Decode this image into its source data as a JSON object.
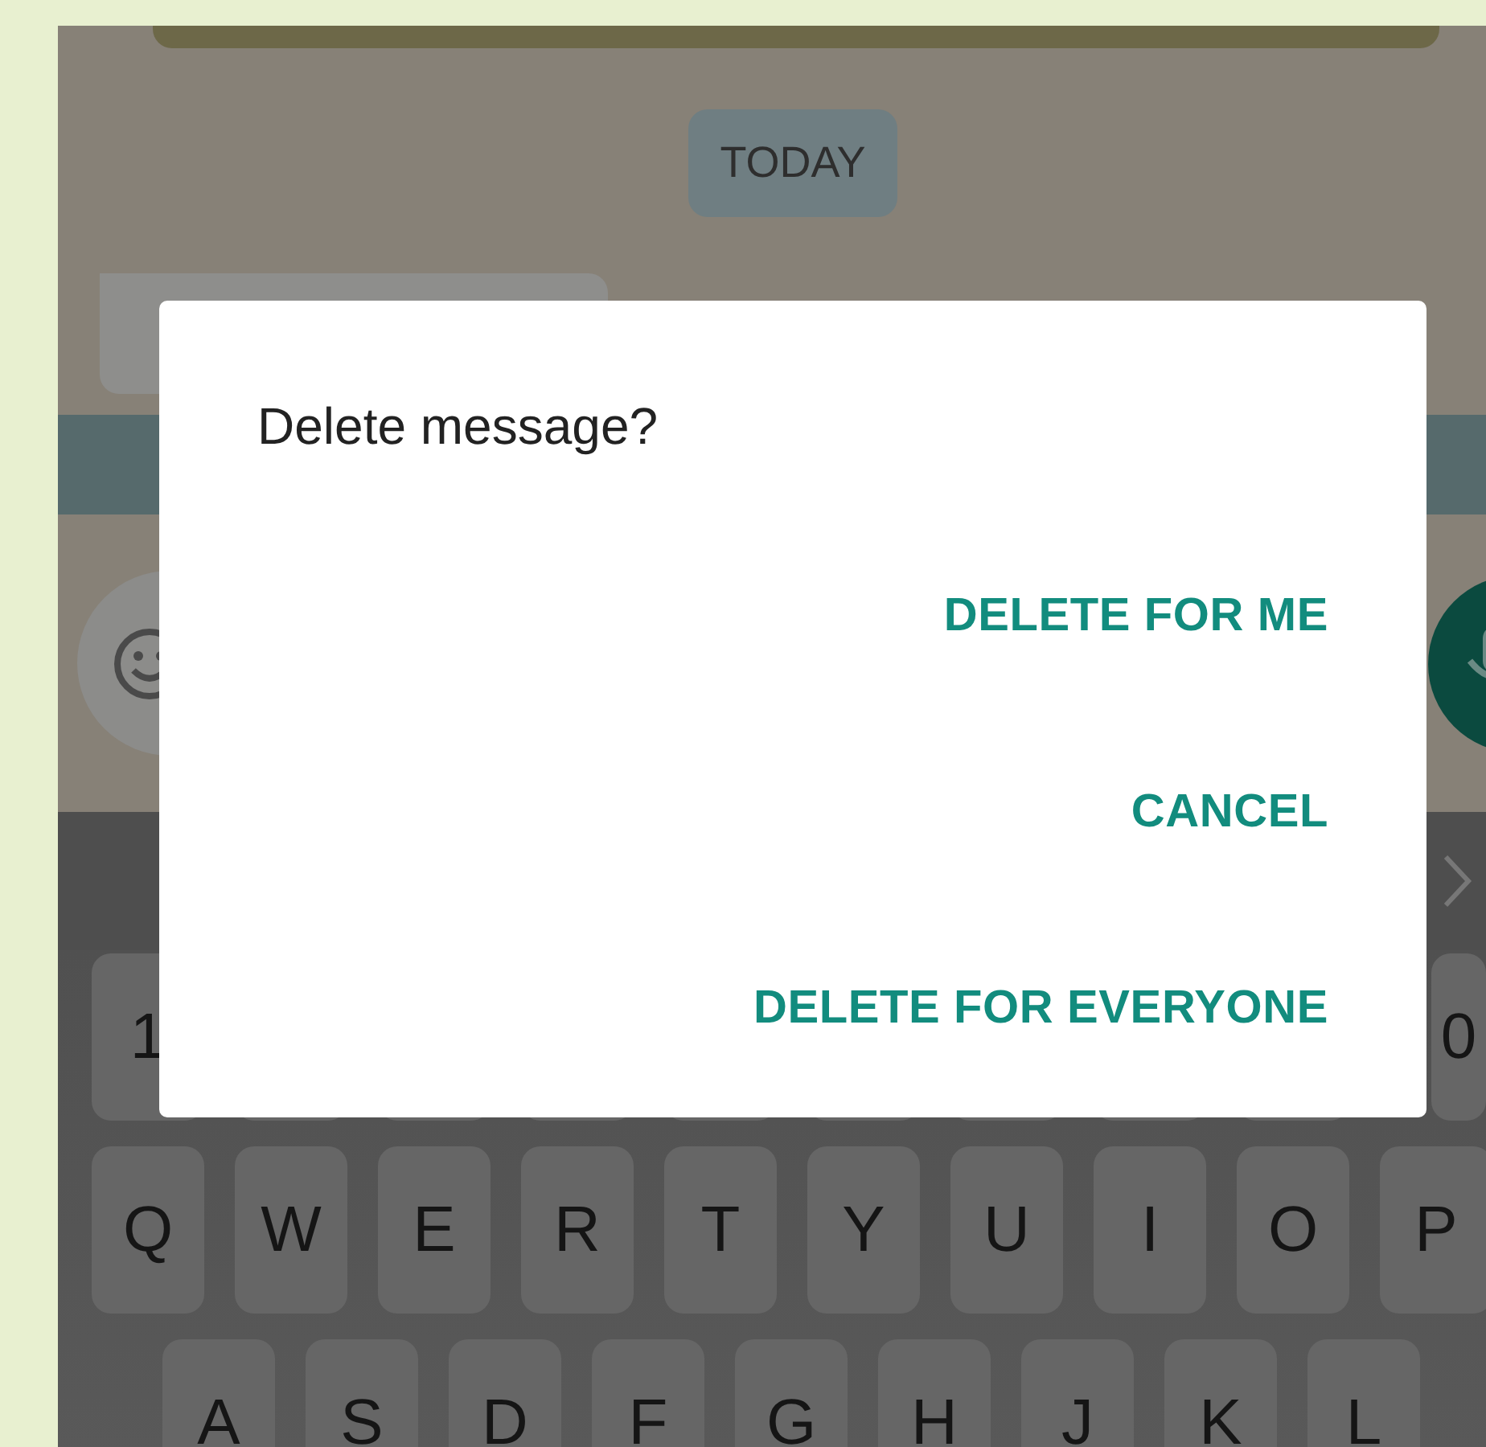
{
  "chat": {
    "date_chip": "TODAY"
  },
  "keyboard": {
    "number_row": [
      "1",
      "0"
    ],
    "rows": [
      [
        "Q",
        "W",
        "E",
        "R",
        "T",
        "Y",
        "U",
        "I",
        "O",
        "P"
      ],
      [
        "A",
        "S",
        "D",
        "F",
        "G",
        "H",
        "J",
        "K",
        "L"
      ]
    ]
  },
  "dialog": {
    "title": "Delete message?",
    "actions": [
      "DELETE FOR ME",
      "CANCEL",
      "DELETE FOR EVERYONE"
    ]
  }
}
